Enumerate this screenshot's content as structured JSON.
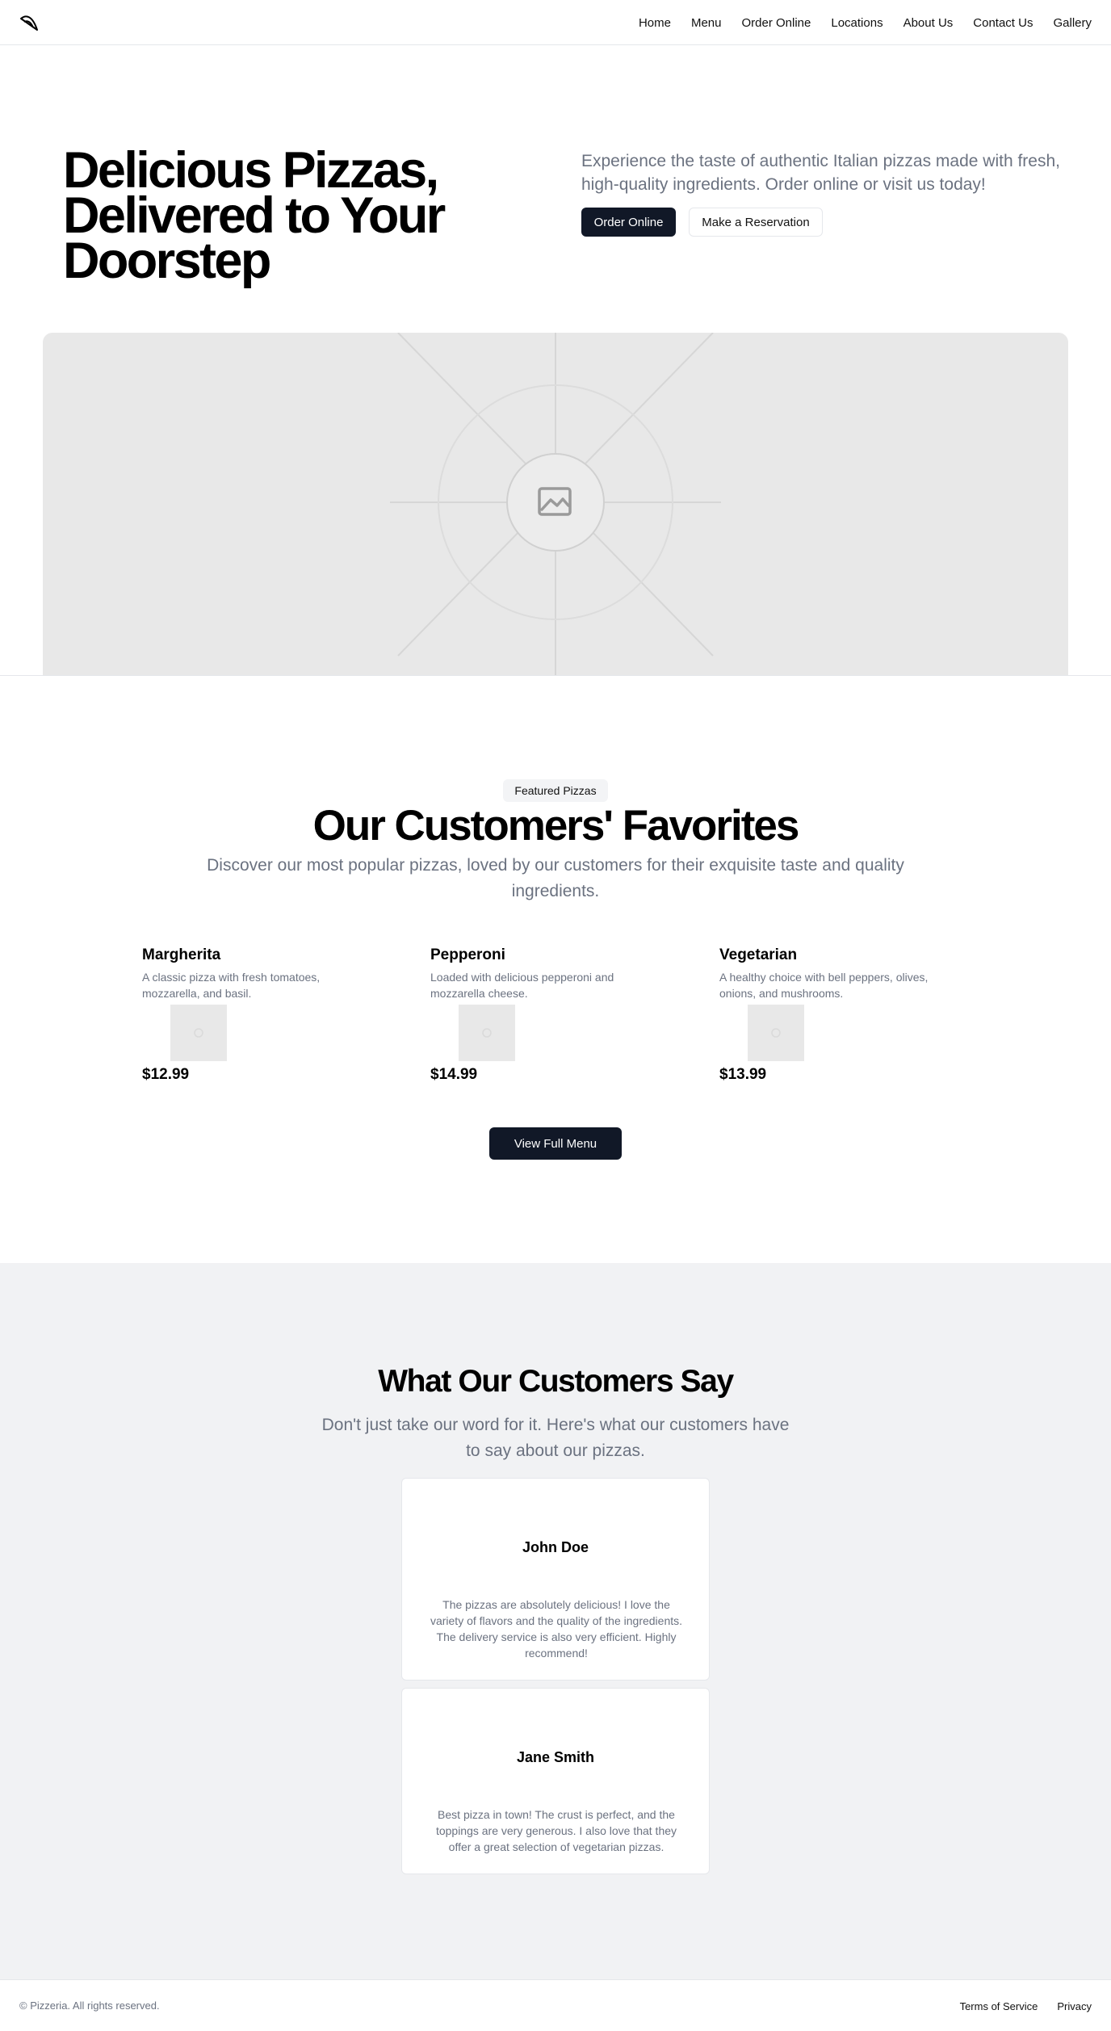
{
  "nav": {
    "items": [
      "Home",
      "Menu",
      "Order Online",
      "Locations",
      "About Us",
      "Contact Us",
      "Gallery"
    ]
  },
  "hero": {
    "title": "Delicious Pizzas, Delivered to Your Doorstep",
    "description": "Experience the taste of authentic Italian pizzas made with fresh, high-quality ingredients. Order online or visit us today!",
    "primary_button": "Order Online",
    "secondary_button": "Make a Reservation",
    "image_icon": "image-placeholder-icon"
  },
  "featured": {
    "badge": "Featured Pizzas",
    "title": "Our Customers' Favorites",
    "subtitle": "Discover our most popular pizzas, loved by our customers for their exquisite taste and quality ingredients.",
    "pizzas": [
      {
        "name": "Margherita",
        "description": "A classic pizza with fresh tomatoes, mozzarella, and basil.",
        "price": "$12.99"
      },
      {
        "name": "Pepperoni",
        "description": "Loaded with delicious pepperoni and mozzarella cheese.",
        "price": "$14.99"
      },
      {
        "name": "Vegetarian",
        "description": "A healthy choice with bell peppers, olives, onions, and mushrooms.",
        "price": "$13.99"
      }
    ],
    "menu_button": "View Full Menu"
  },
  "testimonials": {
    "title": "What Our Customers Say",
    "subtitle": "Don't just take our word for it. Here's what our customers have to say about our pizzas.",
    "items": [
      {
        "name": "John Doe",
        "quote": "The pizzas are absolutely delicious! I love the variety of flavors and the quality of the ingredients. The delivery service is also very efficient. Highly recommend!"
      },
      {
        "name": "Jane Smith",
        "quote": "Best pizza in town! The crust is perfect, and the toppings are very generous. I also love that they offer a great selection of vegetarian pizzas."
      }
    ]
  },
  "footer": {
    "copyright": "© Pizzeria. All rights reserved.",
    "links": [
      "Terms of Service",
      "Privacy"
    ]
  },
  "colors": {
    "primary_button": "#111827",
    "muted_text": "#6b7280",
    "section_bg": "#f1f2f4",
    "placeholder_bg": "#e8e8e8"
  }
}
